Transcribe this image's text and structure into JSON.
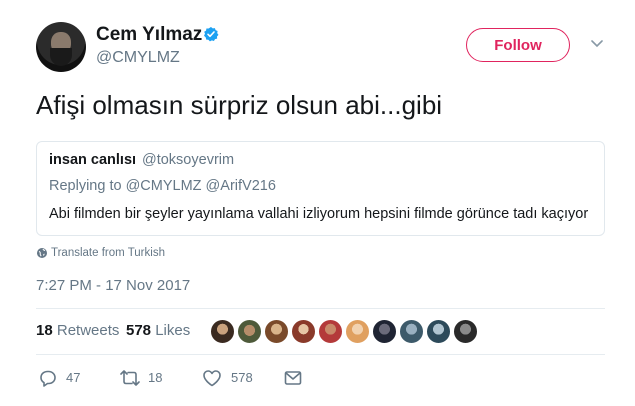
{
  "author": {
    "name": "Cem Yılmaz",
    "handle": "@CMYLMZ",
    "verified": true
  },
  "follow_label": "Follow",
  "tweet_text": "Afişi olmasın sürpriz olsun abi...gibi",
  "quoted": {
    "name": "insan canlısı",
    "handle": "@toksoyevrim",
    "replying_prefix": "Replying to",
    "replying_to": "@CMYLMZ @ArifV216",
    "text": "Abi filmden bir şeyler yayınlama vallahi izliyorum hepsini filmde görünce tadı kaçıyor"
  },
  "translate_label": "Translate from Turkish",
  "timestamp": "7:27 PM - 17 Nov 2017",
  "stats": {
    "retweets_count": "18",
    "retweets_label": "Retweets",
    "likes_count": "578",
    "likes_label": "Likes"
  },
  "actions": {
    "replies": "47",
    "retweets": "18",
    "likes": "578"
  },
  "colors": {
    "accent": "#e0245e",
    "link": "#1da1f2",
    "muted": "#657786",
    "text": "#14171a"
  },
  "icons": [
    "verified-badge-icon",
    "chevron-down-icon",
    "globe-icon",
    "reply-icon",
    "retweet-icon",
    "heart-icon",
    "message-icon"
  ]
}
